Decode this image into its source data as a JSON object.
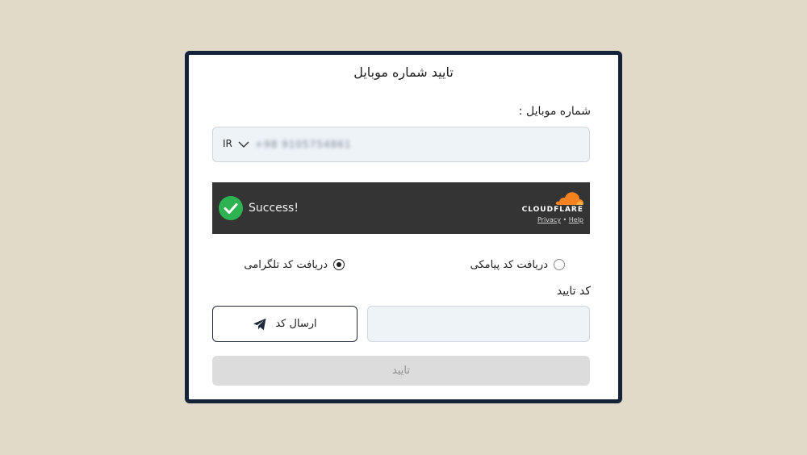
{
  "card": {
    "title": "تایید شماره موبایل",
    "mobile_label": "شماره موبایل :",
    "phone": {
      "country_code": "IR",
      "value_masked": "+98 9105754861"
    },
    "cloudflare": {
      "status": "Success!",
      "brand": "CLOUDFLARE",
      "privacy": "Privacy",
      "separator": "•",
      "help": "Help",
      "brand_color": "#f6821f",
      "success_color": "#2eb352"
    },
    "delivery": {
      "sms_label": "دریافت کد پیامکی",
      "telegram_label": "دریافت کد تلگرامی",
      "selected": "telegram"
    },
    "code_label": "کد تایید",
    "code_input_value": "",
    "send_button_label": "ارسال کد",
    "confirm_button_label": "تایید"
  }
}
